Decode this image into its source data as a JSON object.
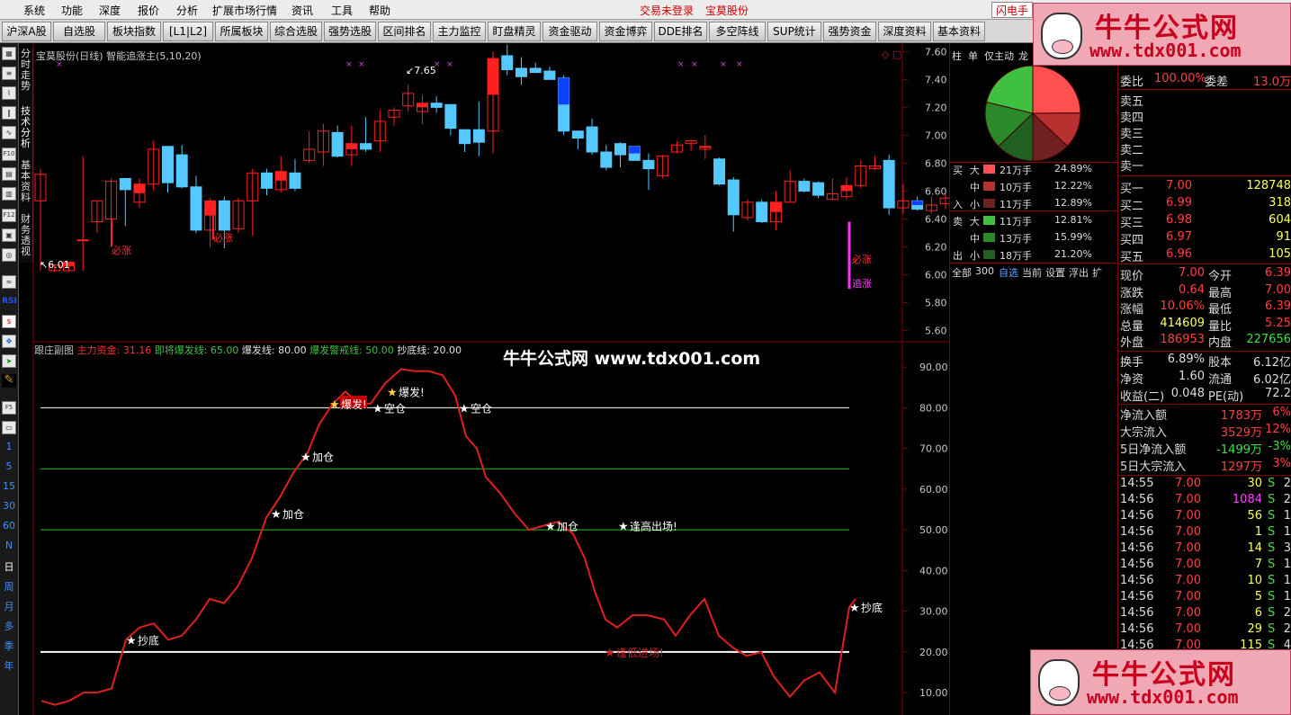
{
  "menu": {
    "items": [
      "系统",
      "功能",
      "深度",
      "报价",
      "分析",
      "扩展市场行情",
      "资讯",
      "工具",
      "帮助"
    ],
    "status_unlogged": "交易未登录",
    "status_stock": "宝莫股份",
    "flash": "闪电手"
  },
  "toolbar": [
    "沪深A股",
    "自选股",
    "板块指数",
    "[L1|L2]",
    "所属板块",
    "综合选股",
    "强势选股",
    "区间排名",
    "主力监控",
    "盯盘精灵",
    "资金驱动",
    "资金博弈",
    "DDE排名",
    "多空阵线",
    "SUP统计",
    "强势资金",
    "深度资料",
    "基本资料"
  ],
  "sidebar": {
    "vtabs": [
      "分时走势",
      "技术分析",
      "基本资料",
      "财务透视"
    ],
    "rsi": "RSI",
    "periods": [
      "1",
      "5",
      "15",
      "30",
      "60",
      "N",
      "日",
      "周",
      "月",
      "多",
      "季",
      "年"
    ]
  },
  "main_chart": {
    "header": "宝莫股份(日线) 智能追涨主(5,10,20)",
    "y_ticks": [
      "7.60",
      "7.40",
      "7.20",
      "7.00",
      "6.80",
      "6.60",
      "6.40",
      "6.20",
      "6.00",
      "5.80",
      "5.60"
    ],
    "y_range": [
      5.52,
      7.66
    ],
    "high_label": "7.65",
    "low_label": "6.01",
    "signal_labels": [
      "必涨",
      "必涨",
      "必涨",
      "追涨"
    ],
    "candles": [
      [
        6.53,
        6.72,
        6.76,
        6.03
      ],
      [
        6.03,
        6.07,
        6.07,
        6.02
      ],
      [
        6.03,
        6.09,
        6.07,
        6.02
      ],
      [
        6.25,
        6.25,
        6.85,
        6.03
      ],
      [
        6.38,
        6.53,
        6.53,
        6.3
      ],
      [
        6.4,
        6.67,
        6.69,
        6.32
      ],
      [
        6.69,
        6.61,
        6.63,
        6.35
      ],
      [
        6.52,
        6.65,
        6.69,
        6.48
      ],
      [
        6.65,
        6.9,
        6.96,
        6.6
      ],
      [
        6.92,
        6.66,
        6.87,
        6.59
      ],
      [
        6.86,
        6.63,
        6.93,
        6.62
      ],
      [
        6.63,
        6.32,
        6.71,
        6.3
      ],
      [
        6.32,
        6.53,
        6.55,
        6.2
      ],
      [
        6.53,
        6.32,
        6.56,
        6.19
      ],
      [
        6.33,
        6.53,
        6.55,
        6.3
      ],
      [
        6.53,
        6.73,
        6.76,
        6.28
      ],
      [
        6.73,
        6.62,
        6.76,
        6.57
      ],
      [
        6.61,
        6.74,
        6.85,
        6.59
      ],
      [
        6.73,
        6.62,
        6.83,
        6.6
      ],
      [
        6.82,
        6.9,
        7.03,
        6.8
      ],
      [
        6.88,
        7.03,
        7.08,
        6.78
      ],
      [
        7.02,
        6.85,
        7.07,
        6.84
      ],
      [
        6.86,
        6.94,
        7.07,
        6.78
      ],
      [
        6.94,
        6.9,
        7.13,
        6.88
      ],
      [
        6.96,
        7.1,
        7.18,
        6.88
      ],
      [
        7.13,
        7.18,
        7.2,
        7.07
      ],
      [
        7.21,
        7.3,
        7.36,
        7.17
      ],
      [
        7.17,
        7.23,
        7.29,
        7.08
      ],
      [
        7.23,
        7.2,
        7.28,
        7.16
      ],
      [
        7.22,
        7.05,
        7.2,
        7.0
      ],
      [
        7.04,
        6.94,
        7.04,
        6.88
      ],
      [
        7.04,
        6.95,
        7.24,
        6.85
      ],
      [
        7.03,
        7.55,
        7.6,
        6.87
      ],
      [
        7.57,
        7.47,
        7.65,
        7.43
      ],
      [
        7.48,
        7.42,
        7.56,
        7.36
      ],
      [
        7.48,
        7.45,
        7.52,
        7.46
      ],
      [
        7.46,
        7.4,
        7.49,
        7.4
      ],
      [
        7.41,
        7.03,
        7.43,
        7.0
      ],
      [
        7.03,
        6.98,
        7.03,
        6.9
      ],
      [
        7.06,
        6.88,
        7.12,
        6.86
      ],
      [
        6.88,
        6.77,
        6.93,
        6.75
      ],
      [
        6.94,
        6.86,
        6.95,
        6.77
      ],
      [
        6.92,
        6.82,
        6.92,
        6.82
      ],
      [
        6.82,
        6.76,
        6.87,
        6.61
      ],
      [
        6.71,
        6.85,
        6.86,
        6.69
      ],
      [
        6.88,
        6.93,
        6.96,
        6.87
      ],
      [
        6.94,
        6.96,
        6.97,
        6.89
      ],
      [
        6.9,
        6.92,
        7.0,
        6.83
      ],
      [
        6.83,
        6.65,
        6.84,
        6.64
      ],
      [
        6.68,
        6.43,
        6.7,
        6.31
      ],
      [
        6.41,
        6.52,
        6.54,
        6.39
      ],
      [
        6.52,
        6.38,
        6.54,
        6.37
      ],
      [
        6.38,
        6.52,
        6.6,
        6.32
      ],
      [
        6.52,
        6.67,
        6.75,
        6.52
      ],
      [
        6.67,
        6.6,
        6.69,
        6.59
      ],
      [
        6.66,
        6.57,
        6.67,
        6.55
      ],
      [
        6.54,
        6.58,
        6.69,
        6.54
      ],
      [
        6.56,
        6.64,
        6.7,
        6.54
      ],
      [
        6.64,
        6.78,
        6.82,
        6.62
      ],
      [
        6.76,
        6.78,
        6.85,
        6.75
      ],
      [
        6.82,
        6.48,
        6.86,
        6.43
      ],
      [
        6.48,
        6.53,
        6.65,
        6.44
      ],
      [
        6.53,
        6.47,
        6.56,
        6.46
      ],
      [
        6.46,
        6.5,
        6.56,
        6.44
      ],
      [
        6.51,
        6.55,
        6.58,
        6.47
      ],
      [
        6.57,
        6.38,
        6.63,
        6.37
      ],
      [
        6.38,
        6.35,
        6.38,
        6.33
      ],
      [
        6.34,
        6.37,
        6.41,
        6.33
      ],
      [
        6.37,
        6.52,
        6.54,
        6.36
      ],
      [
        6.52,
        6.51,
        6.59,
        6.5
      ],
      [
        6.51,
        6.38,
        6.55,
        6.37
      ],
      [
        6.39,
        7.0,
        7.0,
        6.39
      ]
    ]
  },
  "sub_chart": {
    "header_parts": [
      {
        "t": "跟庄副图 ",
        "c": "#c0c0c0"
      },
      {
        "t": "主力资金: 31.16 ",
        "c": "#ff3030"
      },
      {
        "t": "即将爆发线: 65.00 ",
        "c": "#40c040"
      },
      {
        "t": "爆发线: 80.00 ",
        "c": "#e0e0e0"
      },
      {
        "t": "爆发警戒线: 50.00 ",
        "c": "#40c040"
      },
      {
        "t": "抄底线: 20.00",
        "c": "#e0e0e0"
      }
    ],
    "y_ticks": [
      "90.00",
      "80.00",
      "70.00",
      "60.00",
      "50.00",
      "40.00",
      "30.00",
      "20.00",
      "10.00"
    ],
    "y_range": [
      4.5,
      96
    ],
    "lines": [
      {
        "v": 80,
        "c": "#ffffff",
        "w": 1
      },
      {
        "v": 65,
        "c": "#20c020",
        "w": 1
      },
      {
        "v": 50,
        "c": "#20c020",
        "w": 1
      },
      {
        "v": 20,
        "c": "#ffffff",
        "w": 2
      }
    ],
    "series": [
      [
        46,
        8
      ],
      [
        61,
        7
      ],
      [
        77,
        8
      ],
      [
        93,
        10
      ],
      [
        108,
        10
      ],
      [
        124,
        11
      ],
      [
        140,
        23
      ],
      [
        155,
        26
      ],
      [
        171,
        27
      ],
      [
        187,
        23
      ],
      [
        202,
        24
      ],
      [
        218,
        28
      ],
      [
        233,
        33
      ],
      [
        249,
        32
      ],
      [
        264,
        36
      ],
      [
        280,
        43
      ],
      [
        296,
        53
      ],
      [
        311,
        58
      ],
      [
        326,
        64
      ],
      [
        342,
        69
      ],
      [
        355,
        76
      ],
      [
        370,
        81
      ],
      [
        384,
        84
      ],
      [
        398,
        81
      ],
      [
        412,
        81
      ],
      [
        428,
        86
      ],
      [
        446,
        89.5
      ],
      [
        461,
        89
      ],
      [
        477,
        89
      ],
      [
        492,
        88
      ],
      [
        506,
        83
      ],
      [
        518,
        73
      ],
      [
        530,
        70
      ],
      [
        540,
        63
      ],
      [
        556,
        59
      ],
      [
        572,
        54
      ],
      [
        588,
        50
      ],
      [
        604,
        51
      ],
      [
        620,
        52
      ],
      [
        637,
        49
      ],
      [
        650,
        43
      ],
      [
        661,
        35
      ],
      [
        673,
        28
      ],
      [
        686,
        26
      ],
      [
        703,
        29
      ],
      [
        720,
        29
      ],
      [
        738,
        28
      ],
      [
        751,
        24
      ],
      [
        767,
        29
      ],
      [
        783,
        33
      ],
      [
        799,
        24
      ],
      [
        815,
        21
      ],
      [
        830,
        19
      ],
      [
        846,
        20
      ],
      [
        860,
        14
      ],
      [
        878,
        9
      ],
      [
        894,
        13
      ],
      [
        911,
        15
      ],
      [
        928,
        10
      ],
      [
        944,
        31
      ],
      [
        951,
        33
      ]
    ],
    "annotations": [
      {
        "t": "抄底",
        "x": 140,
        "v": 23,
        "c": "#ffffff",
        "s": "#ffffff"
      },
      {
        "t": "加仓",
        "x": 301,
        "v": 54,
        "c": "#ffffff",
        "s": "#ffffff"
      },
      {
        "t": "加仓",
        "x": 334,
        "v": 68,
        "c": "#ffffff",
        "s": "#ffffff"
      },
      {
        "t": "爆发!",
        "x": 366,
        "v": 81,
        "c": "#ffffff",
        "s": "#ffd040",
        "bg": "#c00000"
      },
      {
        "t": "空仓",
        "x": 414,
        "v": 80,
        "c": "#ffffff",
        "s": "#ffffff"
      },
      {
        "t": "爆发!",
        "x": 430,
        "v": 84,
        "c": "#ffffff",
        "s": "#ffd040"
      },
      {
        "t": "空仓",
        "x": 510,
        "v": 80,
        "c": "#ffffff",
        "s": "#ffffff"
      },
      {
        "t": "加仓",
        "x": 606,
        "v": 51,
        "c": "#ffffff",
        "s": "#ffffff"
      },
      {
        "t": "逢高出场!",
        "x": 687,
        "v": 51,
        "c": "#ffffff",
        "s": "#ffffff"
      },
      {
        "t": "逢低进场!",
        "x": 672,
        "v": 20,
        "c": "#d02020",
        "s": "#d02020"
      },
      {
        "t": "抄底",
        "x": 944,
        "v": 31,
        "c": "#ffffff",
        "s": "#ffffff"
      }
    ]
  },
  "watermark_center": "牛牛公式网 www.tdx001.com",
  "watermark": {
    "title": "牛牛公式网",
    "url": "www.tdx001.com"
  },
  "midpanel": {
    "tabs": [
      "柱",
      "单",
      "仅主动",
      "龙"
    ],
    "pie": [
      {
        "share": 24.89,
        "c": "#ff5050"
      },
      {
        "share": 12.22,
        "c": "#b83030"
      },
      {
        "share": 12.89,
        "c": "#702020"
      },
      {
        "share": 12.81,
        "c": "#206020"
      },
      {
        "share": 15.99,
        "c": "#2a8a2a"
      },
      {
        "share": 21.2,
        "c": "#40c040"
      }
    ],
    "buy": [
      {
        "lab": "大",
        "amt": "21万手",
        "pct": "24.89%",
        "c": "#ff5050"
      },
      {
        "lab": "中",
        "amt": "10万手",
        "pct": "12.22%",
        "c": "#b83030"
      },
      {
        "lab": "小",
        "amt": "11万手",
        "pct": "12.89%",
        "c": "#702020"
      }
    ],
    "sell": [
      {
        "lab": "大",
        "amt": "11万手",
        "pct": "12.81%",
        "c": "#40c040"
      },
      {
        "lab": "中",
        "amt": "13万手",
        "pct": "15.99%",
        "c": "#2a8a2a"
      },
      {
        "lab": "小",
        "amt": "18万手",
        "pct": "21.20%",
        "c": "#206020"
      }
    ],
    "buy_side": [
      "买",
      "入"
    ],
    "sell_side": [
      "卖",
      "出"
    ],
    "bottom": [
      "全部",
      "300",
      "自选",
      "当前",
      "设置",
      "浮出",
      "扩"
    ]
  },
  "quote": {
    "weibi_lab": "委比",
    "weibi": "100.00%",
    "weicha_lab": "委差",
    "weicha": "13.0万",
    "asks": [
      "卖五",
      "卖四",
      "卖三",
      "卖二",
      "卖一"
    ],
    "bids": [
      {
        "lab": "买一",
        "p": "7.00",
        "v": "128748"
      },
      {
        "lab": "买二",
        "p": "6.99",
        "v": "318"
      },
      {
        "lab": "买三",
        "p": "6.98",
        "v": "604"
      },
      {
        "lab": "买四",
        "p": "6.97",
        "v": "91"
      },
      {
        "lab": "买五",
        "p": "6.96",
        "v": "105"
      }
    ],
    "stats": [
      {
        "l1": "现价",
        "v1": "7.00",
        "c1": "#ff4040",
        "l2": "今开",
        "v2": "6.39",
        "c2": "#ff4040"
      },
      {
        "l1": "涨跌",
        "v1": "0.64",
        "c1": "#ff4040",
        "l2": "最高",
        "v2": "7.00",
        "c2": "#ff4040"
      },
      {
        "l1": "涨幅",
        "v1": "10.06%",
        "c1": "#ff4040",
        "l2": "最低",
        "v2": "6.39",
        "c2": "#ff4040"
      },
      {
        "l1": "总量",
        "v1": "414609",
        "c1": "#ffff60",
        "l2": "量比",
        "v2": "5.25",
        "c2": "#ff4040"
      },
      {
        "l1": "外盘",
        "v1": "186953",
        "c1": "#ff4040",
        "l2": "内盘",
        "v2": "227656",
        "c2": "#40e040"
      }
    ],
    "stats2": [
      {
        "l1": "换手",
        "v1": "6.89%",
        "l2": "股本",
        "v2": "6.12亿"
      },
      {
        "l1": "净资",
        "v1": "1.60",
        "l2": "流通",
        "v2": "6.02亿"
      },
      {
        "l1": "收益(二)",
        "v1": "0.048",
        "l2": "PE(动)",
        "v2": "72.2"
      }
    ],
    "flow": [
      {
        "l": "净流入额",
        "v": "1783万",
        "p": "6%"
      },
      {
        "l": "大宗流入",
        "v": "3529万",
        "p": "12%"
      },
      {
        "l": "5日净流入额",
        "v": "-1499万",
        "p": "-3%",
        "neg": true
      },
      {
        "l": "5日大宗流入",
        "v": "1297万",
        "p": "3%"
      }
    ],
    "ticks": [
      {
        "t": "14:55",
        "p": "7.00",
        "v": "30",
        "s": "S",
        "n": "2"
      },
      {
        "t": "14:56",
        "p": "7.00",
        "v": "1084",
        "s": "S",
        "n": "2",
        "big": true
      },
      {
        "t": "14:56",
        "p": "7.00",
        "v": "56",
        "s": "S",
        "n": "1"
      },
      {
        "t": "14:56",
        "p": "7.00",
        "v": "1",
        "s": "S",
        "n": "1"
      },
      {
        "t": "14:56",
        "p": "7.00",
        "v": "14",
        "s": "S",
        "n": "3"
      },
      {
        "t": "14:56",
        "p": "7.00",
        "v": "7",
        "s": "S",
        "n": "1"
      },
      {
        "t": "14:56",
        "p": "7.00",
        "v": "10",
        "s": "S",
        "n": "1"
      },
      {
        "t": "14:56",
        "p": "7.00",
        "v": "5",
        "s": "S",
        "n": "1"
      },
      {
        "t": "14:56",
        "p": "7.00",
        "v": "6",
        "s": "S",
        "n": "2"
      },
      {
        "t": "14:56",
        "p": "7.00",
        "v": "29",
        "s": "S",
        "n": "2"
      },
      {
        "t": "14:56",
        "p": "7.00",
        "v": "115",
        "s": "S",
        "n": "4"
      }
    ]
  }
}
